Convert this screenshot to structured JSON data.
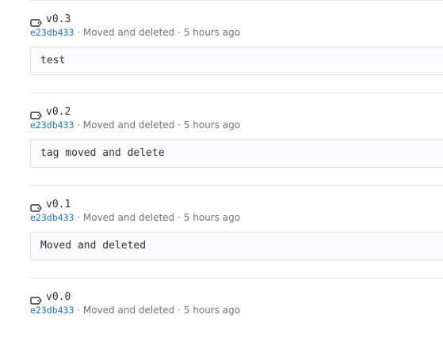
{
  "tags": [
    {
      "name": "v0.3",
      "sha": "e23db433",
      "separator1": "·",
      "commit_title": "Moved and deleted",
      "separator2": "·",
      "time": "5 hours ago",
      "message": "test"
    },
    {
      "name": "v0.2",
      "sha": "e23db433",
      "separator1": "·",
      "commit_title": "Moved and deleted",
      "separator2": "·",
      "time": "5 hours ago",
      "message": "tag moved and delete"
    },
    {
      "name": "v0.1",
      "sha": "e23db433",
      "separator1": "·",
      "commit_title": "Moved and deleted",
      "separator2": "·",
      "time": "5 hours ago",
      "message": "Moved and deleted"
    },
    {
      "name": "v0.0",
      "sha": "e23db433",
      "separator1": "·",
      "commit_title": "Moved and deleted",
      "separator2": "·",
      "time": "5 hours ago"
    }
  ],
  "icons": {
    "tag": "tag-icon"
  },
  "colors": {
    "link": "#1f75cb",
    "meta": "#737278",
    "text": "#303030",
    "message_bg": "#fbfafd",
    "border": "#dcdcde"
  }
}
